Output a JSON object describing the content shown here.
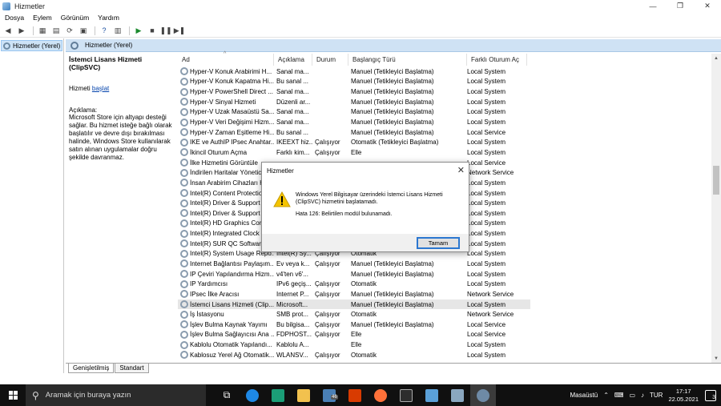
{
  "window": {
    "title": "Hizmetler",
    "controls": {
      "minimize": "—",
      "maximize": "❐",
      "close": "✕"
    }
  },
  "menu": [
    "Dosya",
    "Eylem",
    "Görünüm",
    "Yardım"
  ],
  "tree": {
    "root": "Hizmetler (Yerel)"
  },
  "header": {
    "title": "Hizmetler (Yerel)"
  },
  "description_pane": {
    "service_title": "İstemci Lisans Hizmeti (ClipSVC)",
    "start_prefix": "Hizmeti ",
    "start_link": "başlat",
    "desc_label": "Açıklama:",
    "desc_text": "Microsoft Store için altyapı desteği sağlar. Bu hizmet isteğe bağlı olarak başlatılır ve devre dışı bırakılması halinde, Windows Store kullanılarak satın alınan uygulamalar doğru şekilde davranmaz."
  },
  "table": {
    "columns": [
      "Ad",
      "Açıklama",
      "Durum",
      "Başlangıç Türü",
      "Farklı Oturum Aç"
    ],
    "rows": [
      {
        "name": "Hyper-V Konuk Arabirimi H...",
        "desc": "Sanal ma...",
        "status": "",
        "start": "Manuel (Tetikleyici Başlatma)",
        "logon": "Local System"
      },
      {
        "name": "Hyper-V Konuk Kapatma Hi...",
        "desc": "Bu sanal ...",
        "status": "",
        "start": "Manuel (Tetikleyici Başlatma)",
        "logon": "Local System"
      },
      {
        "name": "Hyper-V PowerShell Direct ...",
        "desc": "Sanal ma...",
        "status": "",
        "start": "Manuel (Tetikleyici Başlatma)",
        "logon": "Local System"
      },
      {
        "name": "Hyper-V Sinyal Hizmeti",
        "desc": "Düzenli ar...",
        "status": "",
        "start": "Manuel (Tetikleyici Başlatma)",
        "logon": "Local System"
      },
      {
        "name": "Hyper-V Uzak Masaüstü Sa...",
        "desc": "Sanal ma...",
        "status": "",
        "start": "Manuel (Tetikleyici Başlatma)",
        "logon": "Local System"
      },
      {
        "name": "Hyper-V Veri Değişimi Hizm...",
        "desc": "Sanal ma...",
        "status": "",
        "start": "Manuel (Tetikleyici Başlatma)",
        "logon": "Local System"
      },
      {
        "name": "Hyper-V Zaman Eşitleme Hi...",
        "desc": "Bu sanal ...",
        "status": "",
        "start": "Manuel (Tetikleyici Başlatma)",
        "logon": "Local Service"
      },
      {
        "name": "IKE ve AuthIP IPsec Anahtar...",
        "desc": "IKEEXT hiz...",
        "status": "Çalışıyor",
        "start": "Otomatik (Tetikleyici Başlatma)",
        "logon": "Local System"
      },
      {
        "name": "İkincil Oturum Açma",
        "desc": "Farklı kim...",
        "status": "Çalışıyor",
        "start": "Elle",
        "logon": "Local System"
      },
      {
        "name": "İlke Hizmetini Görüntüle",
        "desc": "",
        "status": "",
        "start": "",
        "logon": "Local Service"
      },
      {
        "name": "İndirilen Haritalar Yönetic",
        "desc": "",
        "status": "",
        "start": "",
        "logon": "Network Service"
      },
      {
        "name": "İnsan Arabirim Cihazları H",
        "desc": "",
        "status": "",
        "start": "",
        "logon": "Local System"
      },
      {
        "name": "Intel(R) Content Protectio",
        "desc": "",
        "status": "",
        "start": "",
        "logon": "Local System"
      },
      {
        "name": "Intel(R) Driver & Support A",
        "desc": "",
        "status": "",
        "start": "",
        "logon": "Local System"
      },
      {
        "name": "Intel(R) Driver & Support A",
        "desc": "",
        "status": "",
        "start": "",
        "logon": "Local System"
      },
      {
        "name": "Intel(R) HD Graphics Cont",
        "desc": "",
        "status": "",
        "start": "",
        "logon": "Local System"
      },
      {
        "name": "Intel(R) Integrated Clock C",
        "desc": "",
        "status": "",
        "start": "",
        "logon": "Local System"
      },
      {
        "name": "Intel(R) SUR QC Software",
        "desc": "",
        "status": "",
        "start": "",
        "logon": "Local System"
      },
      {
        "name": "Intel(R) System Usage Repo...",
        "desc": "Intel(R) Sy...",
        "status": "Çalışıyor",
        "start": "Otomatik",
        "logon": "Local System"
      },
      {
        "name": "Internet Bağlantısı Paylaşım...",
        "desc": "Ev veya k...",
        "status": "Çalışıyor",
        "start": "Manuel (Tetikleyici Başlatma)",
        "logon": "Local System"
      },
      {
        "name": "IP Çeviri Yapılandırma Hizm...",
        "desc": "v4'ten v6'...",
        "status": "",
        "start": "Manuel (Tetikleyici Başlatma)",
        "logon": "Local System"
      },
      {
        "name": "IP Yardımcısı",
        "desc": "IPv6 geçiş...",
        "status": "Çalışıyor",
        "start": "Otomatik",
        "logon": "Local System"
      },
      {
        "name": "IPsec İlke Aracısı",
        "desc": "Internet P...",
        "status": "Çalışıyor",
        "start": "Manuel (Tetikleyici Başlatma)",
        "logon": "Network Service"
      },
      {
        "name": "İstemci Lisans Hizmeti (Clip...",
        "desc": "Microsoft...",
        "status": "",
        "start": "Manuel (Tetikleyici Başlatma)",
        "logon": "Local System",
        "selected": true
      },
      {
        "name": "İş İstasyonu",
        "desc": "SMB prot...",
        "status": "Çalışıyor",
        "start": "Otomatik",
        "logon": "Network Service"
      },
      {
        "name": "İşlev Bulma Kaynak Yayımı",
        "desc": "Bu bilgisa...",
        "status": "Çalışıyor",
        "start": "Manuel (Tetikleyici Başlatma)",
        "logon": "Local Service"
      },
      {
        "name": "İşlev Bulma Sağlayıcısı Ana ...",
        "desc": "FDPHOST...",
        "status": "Çalışıyor",
        "start": "Elle",
        "logon": "Local Service"
      },
      {
        "name": "Kablolu Otomatik Yapılandı...",
        "desc": "Kablolu A...",
        "status": "",
        "start": "Elle",
        "logon": "Local System"
      },
      {
        "name": "Kablosuz Yerel Ağ Otomatik...",
        "desc": "WLANSV...",
        "status": "Çalışıyor",
        "start": "Otomatik",
        "logon": "Local System"
      }
    ]
  },
  "bottom_tabs": [
    "Genişletilmiş",
    "Standart"
  ],
  "dialog": {
    "title": "Hizmetler",
    "message": "Windows Yerel Bilgisayar üzerindeki İstemci Lisans Hizmeti (ClipSVC) hizmetini başlatamadı.",
    "error": "Hata 126: Belirtilen modül bulunamadı.",
    "ok": "Tamam",
    "icon": "warning-icon"
  },
  "taskbar": {
    "search_placeholder": "Aramak için buraya yazın",
    "badge": "46",
    "desktop_label": "Masaüstü",
    "language": "TUR",
    "time": "17:17",
    "date": "22.05.2021",
    "notifications": "3",
    "colors": {
      "edge": "#1e88e5",
      "folder": "#f2c14e",
      "office": "#d83b01",
      "firefox": "#ff7139",
      "terminal": "#2d2d2d",
      "accent": "#2b77d0"
    }
  }
}
